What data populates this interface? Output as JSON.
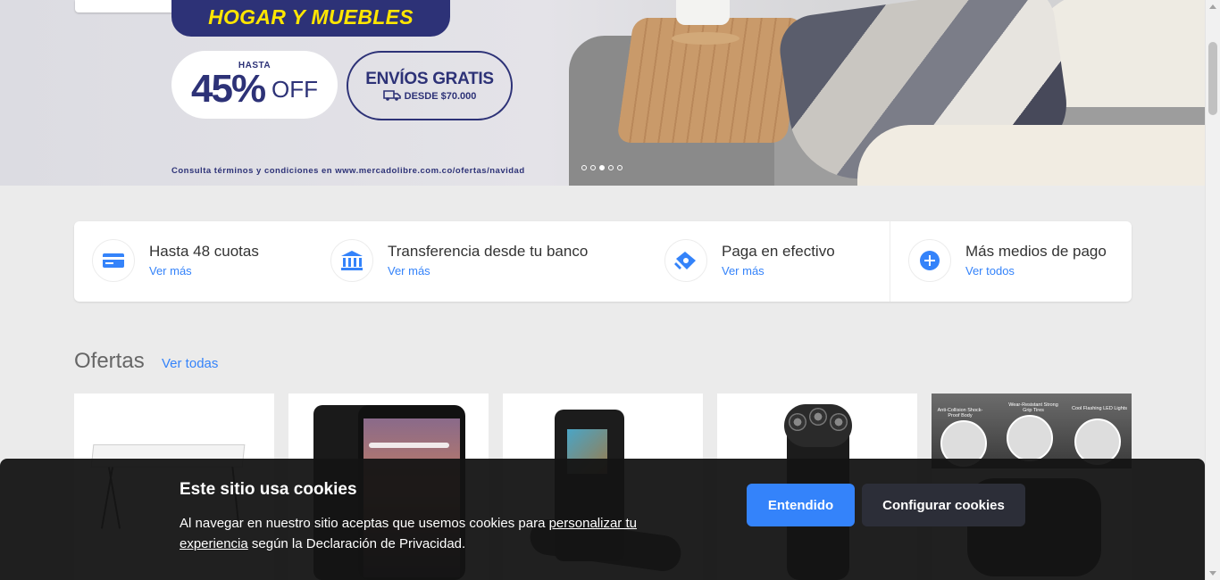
{
  "hero": {
    "title": "HOGAR Y MUEBLES",
    "discount_prefix": "HASTA",
    "discount_value": "45%",
    "discount_suffix": "OFF",
    "shipping_title": "ENVÍOS GRATIS",
    "shipping_subtitle": "DESDE $70.000",
    "legal": "Consulta términos y condiciones en www.mercadolibre.com.co/ofertas/navidad",
    "active_slide": 3,
    "slide_count": 5
  },
  "payments": [
    {
      "title": "Hasta 48 cuotas",
      "link": "Ver más",
      "icon": "credit-card-icon"
    },
    {
      "title": "Transferencia desde tu banco",
      "link": "Ver más",
      "icon": "bank-icon"
    },
    {
      "title": "Paga en efectivo",
      "link": "Ver más",
      "icon": "cash-payment-icon"
    },
    {
      "title": "Más medios de pago",
      "link": "Ver todos",
      "icon": "plus-circle-icon"
    }
  ],
  "offers": {
    "title": "Ofertas",
    "link": "Ver todas",
    "products": [
      {
        "image": "folding-table"
      },
      {
        "image": "tablet"
      },
      {
        "image": "portable-radio"
      },
      {
        "image": "electric-shaver"
      },
      {
        "image": "rc-drone",
        "feature_labels": [
          "Anti-Collision Shock-Proof Body",
          "Wear-Resistant Strong Grip Tires",
          "Cool Flashing LED Lights"
        ]
      }
    ]
  },
  "cookies": {
    "title": "Este sitio usa cookies",
    "text_before": "Al navegar en nuestro sitio aceptas que usemos cookies para ",
    "text_link": "personalizar tu experiencia",
    "text_after": " según la Declaración de Privacidad.",
    "accept_label": "Entendido",
    "configure_label": "Configurar cookies"
  },
  "colors": {
    "brand_blue": "#3483fa",
    "hero_navy": "#2d3277",
    "hero_yellow": "#ffe600"
  }
}
